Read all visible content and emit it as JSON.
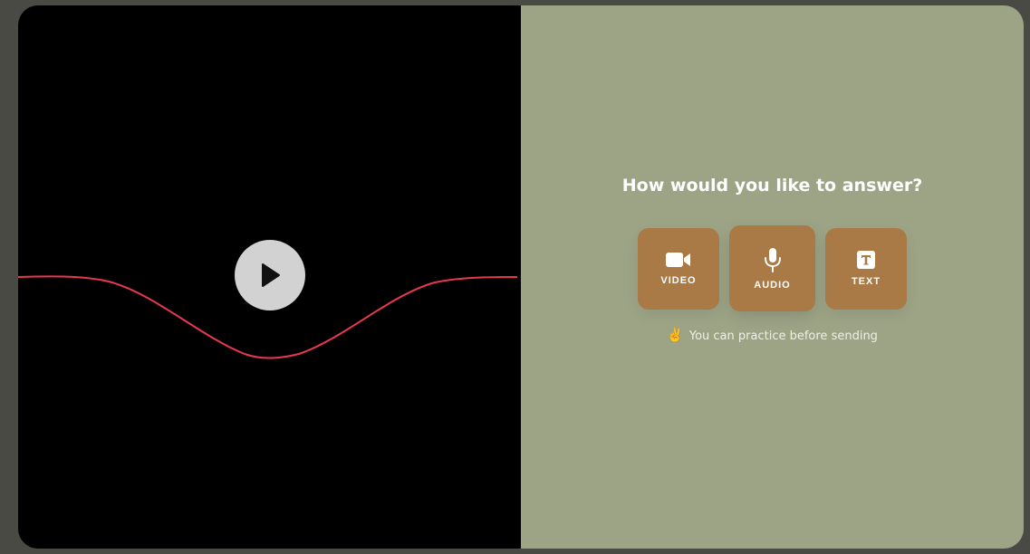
{
  "video": {
    "play_icon": "play-icon",
    "wave_color": "#e8384f"
  },
  "answer": {
    "prompt": "How would you like to answer?",
    "options": [
      {
        "label": "VIDEO",
        "icon": "video-camera-icon"
      },
      {
        "label": "AUDIO",
        "icon": "microphone-icon",
        "selected": true
      },
      {
        "label": "TEXT",
        "icon": "text-icon"
      }
    ],
    "hint_emoji": "✌️",
    "hint_text": "You can practice before sending"
  },
  "colors": {
    "background": "#4a4a45",
    "video_pane": "#000000",
    "answer_pane": "#9da486",
    "option_button": "#a97a45",
    "play_button": "#d2d2d2"
  }
}
